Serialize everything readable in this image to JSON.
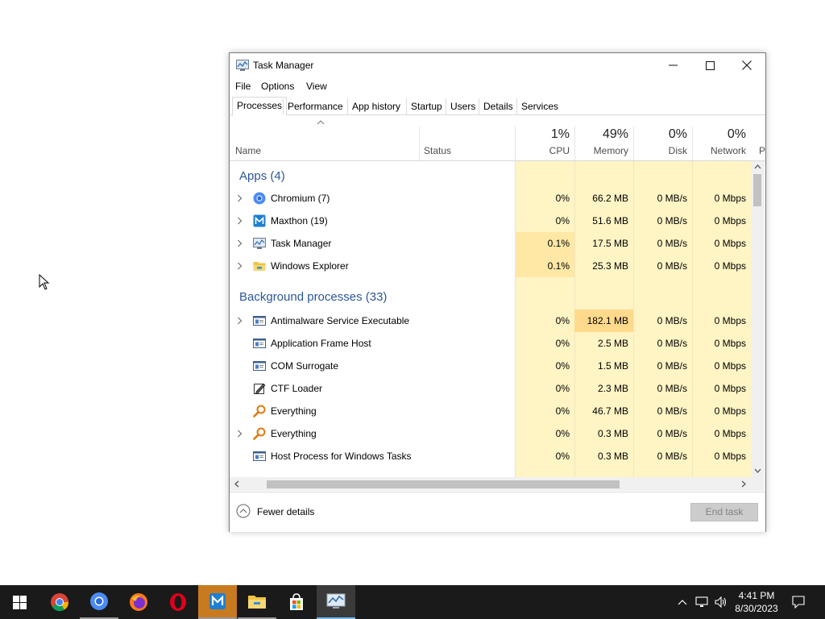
{
  "window": {
    "title": "Task Manager"
  },
  "menu": [
    "File",
    "Options",
    "View"
  ],
  "tabs": [
    "Processes",
    "Performance",
    "App history",
    "Startup",
    "Users",
    "Details",
    "Services"
  ],
  "header": {
    "name": "Name",
    "status": "Status",
    "cpu": {
      "pct": "1%",
      "label": "CPU"
    },
    "memory": {
      "pct": "49%",
      "label": "Memory"
    },
    "disk": {
      "pct": "0%",
      "label": "Disk"
    },
    "network": {
      "pct": "0%",
      "label": "Network"
    },
    "cut": "P"
  },
  "groups": {
    "apps": "Apps (4)",
    "background": "Background processes (33)"
  },
  "apps": [
    {
      "name": "Chromium (7)",
      "icon": "chromium-icon",
      "expand": true,
      "cpu": "0%",
      "memory": "66.2 MB",
      "disk": "0 MB/s",
      "network": "0 Mbps"
    },
    {
      "name": "Maxthon (19)",
      "icon": "maxthon-icon",
      "expand": true,
      "cpu": "0%",
      "memory": "51.6 MB",
      "disk": "0 MB/s",
      "network": "0 Mbps"
    },
    {
      "name": "Task Manager",
      "icon": "task-manager-icon",
      "expand": true,
      "cpu": "0.1%",
      "memory": "17.5 MB",
      "disk": "0 MB/s",
      "network": "0 Mbps"
    },
    {
      "name": "Windows Explorer",
      "icon": "folder-icon",
      "expand": true,
      "cpu": "0.1%",
      "memory": "25.3 MB",
      "disk": "0 MB/s",
      "network": "0 Mbps"
    }
  ],
  "background": [
    {
      "name": "Antimalware Service Executable",
      "icon": "service-icon",
      "expand": true,
      "cpu": "0%",
      "memory": "182.1 MB",
      "disk": "0 MB/s",
      "network": "0 Mbps"
    },
    {
      "name": "Application Frame Host",
      "icon": "service-icon",
      "expand": false,
      "cpu": "0%",
      "memory": "2.5 MB",
      "disk": "0 MB/s",
      "network": "0 Mbps"
    },
    {
      "name": "COM Surrogate",
      "icon": "service-icon",
      "expand": false,
      "cpu": "0%",
      "memory": "1.5 MB",
      "disk": "0 MB/s",
      "network": "0 Mbps"
    },
    {
      "name": "CTF Loader",
      "icon": "ctf-icon",
      "expand": false,
      "cpu": "0%",
      "memory": "2.3 MB",
      "disk": "0 MB/s",
      "network": "0 Mbps"
    },
    {
      "name": "Everything",
      "icon": "everything-icon",
      "expand": false,
      "cpu": "0%",
      "memory": "46.7 MB",
      "disk": "0 MB/s",
      "network": "0 Mbps"
    },
    {
      "name": "Everything",
      "icon": "everything-icon",
      "expand": true,
      "cpu": "0%",
      "memory": "0.3 MB",
      "disk": "0 MB/s",
      "network": "0 Mbps"
    },
    {
      "name": "Host Process for Windows Tasks",
      "icon": "service-icon",
      "expand": false,
      "cpu": "0%",
      "memory": "0.3 MB",
      "disk": "0 MB/s",
      "network": "0 Mbps"
    }
  ],
  "footer": {
    "fewer": "Fewer details",
    "end_task": "End task"
  },
  "taskbar": {
    "apps": [
      "start-icon",
      "chrome-icon",
      "chromium-icon",
      "firefox-icon",
      "opera-icon",
      "maxthon-icon",
      "file-explorer-icon",
      "store-icon",
      "task-manager-icon"
    ],
    "time": "4:41 PM",
    "date": "8/30/2023"
  },
  "colors": {
    "accent": "#2b5797",
    "heat_low": "#fff4c4",
    "heat_mid": "#ffe8a6",
    "heat_high": "#ffd98c",
    "taskbar": "#1a1a1a"
  }
}
